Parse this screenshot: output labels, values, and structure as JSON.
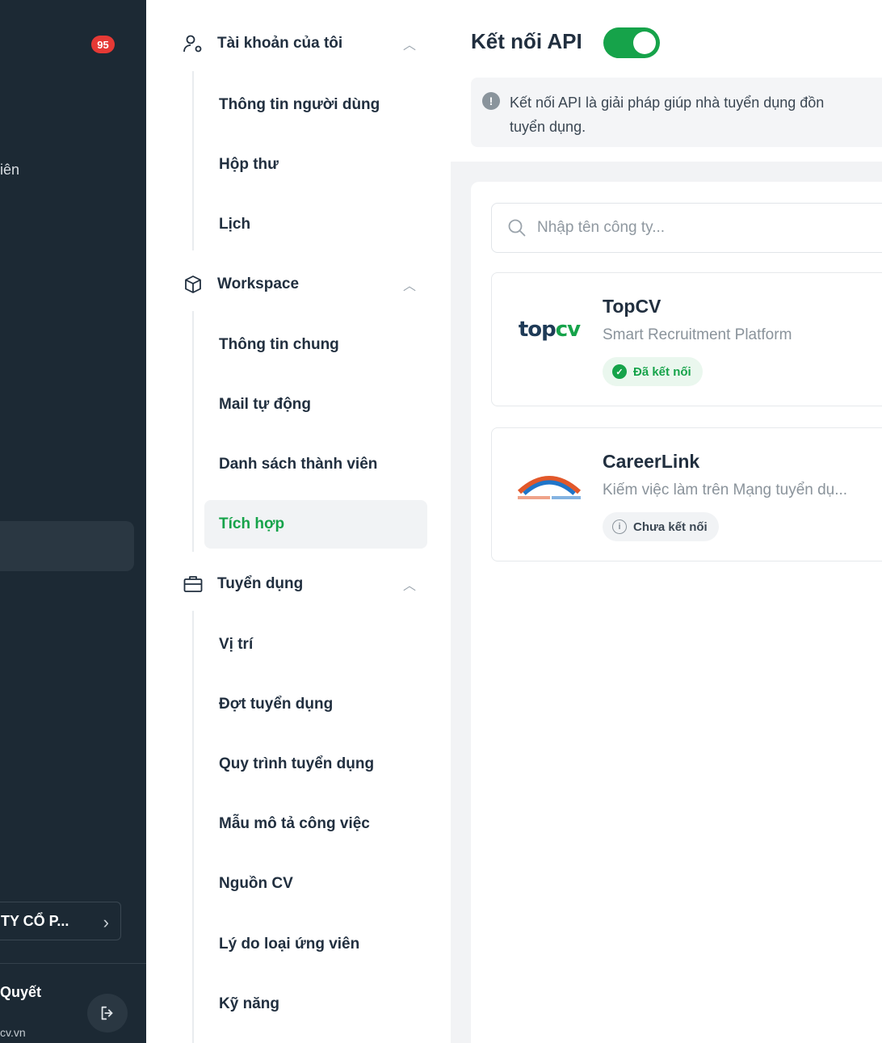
{
  "dark_sidebar": {
    "badge_count": "95",
    "partial_text": "iên",
    "company_label": "TY CỔ P...",
    "user_name": "Quyết",
    "user_email": "cv.vn"
  },
  "settings_nav": {
    "groups": [
      {
        "title": "Tài khoản của tôi",
        "icon": "user-settings-icon",
        "items": [
          "Thông tin người dùng",
          "Hộp thư",
          "Lịch"
        ]
      },
      {
        "title": "Workspace",
        "icon": "cube-icon",
        "items": [
          "Thông tin chung",
          "Mail tự động",
          "Danh sách thành viên",
          "Tích hợp"
        ]
      },
      {
        "title": "Tuyển dụng",
        "icon": "briefcase-icon",
        "items": [
          "Vị trí",
          "Đợt tuyển dụng",
          "Quy trình tuyển dụng",
          "Mẫu mô tả công việc",
          "Nguồn CV",
          "Lý do loại ứng viên",
          "Kỹ năng"
        ]
      }
    ],
    "active_item": "Tích hợp"
  },
  "main": {
    "title": "Kết nối API",
    "toggle_on": true,
    "info_line1": "Kết nối API là giải pháp giúp nhà tuyển dụng đồn",
    "info_line2": "tuyển dụng.",
    "search_placeholder": "Nhập tên công ty...",
    "integrations": [
      {
        "name": "TopCV",
        "description": "Smart Recruitment Platform",
        "status": "Đã kết nối",
        "connected": true,
        "logo": "topcv"
      },
      {
        "name": "CareerLink",
        "description": "Kiếm việc làm trên Mạng tuyển dụ...",
        "status": "Chưa kết nối",
        "connected": false,
        "logo": "careerlink"
      }
    ]
  },
  "colors": {
    "sidebar_bg": "#1c2934",
    "accent_green": "#16a34a",
    "badge_red": "#e53935"
  }
}
